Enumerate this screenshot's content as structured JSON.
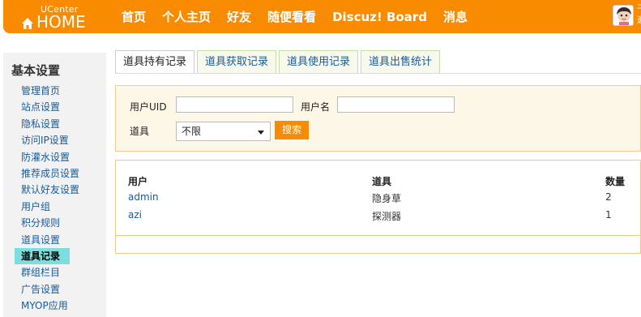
{
  "header": {
    "logo_small": "UCenter",
    "logo_main": "HOME",
    "nav": [
      "首页",
      "个人主页",
      "好友",
      "随便看看",
      "Discuz! Board",
      "消息"
    ],
    "user_tail": "干\n邀"
  },
  "sidebar": {
    "title": "基本设置",
    "items": [
      {
        "label": "管理首页",
        "active": false
      },
      {
        "label": "站点设置",
        "active": false
      },
      {
        "label": "隐私设置",
        "active": false
      },
      {
        "label": "访问IP设置",
        "active": false
      },
      {
        "label": "防灌水设置",
        "active": false
      },
      {
        "label": "推荐成员设置",
        "active": false
      },
      {
        "label": "默认好友设置",
        "active": false
      },
      {
        "label": "用户组",
        "active": false
      },
      {
        "label": "积分规则",
        "active": false
      },
      {
        "label": "道具设置",
        "active": false
      },
      {
        "label": "道具记录",
        "active": true
      },
      {
        "label": "群组栏目",
        "active": false
      },
      {
        "label": "广告设置",
        "active": false
      },
      {
        "label": "MYOP应用",
        "active": false
      }
    ]
  },
  "tabs": [
    {
      "label": "道具持有记录",
      "active": true
    },
    {
      "label": "道具获取记录",
      "active": false
    },
    {
      "label": "道具使用记录",
      "active": false
    },
    {
      "label": "道具出售统计",
      "active": false
    }
  ],
  "search": {
    "uid_label": "用户UID",
    "uid_value": "",
    "username_label": "用户名",
    "username_value": "",
    "item_label": "道具",
    "item_selected": "不限",
    "search_button": "搜索"
  },
  "table": {
    "headers": [
      "用户",
      "道具",
      "数量"
    ],
    "rows": [
      {
        "user": "admin",
        "item": "隐身草",
        "count": "2"
      },
      {
        "user": "azi",
        "item": "探测器",
        "count": "1"
      }
    ]
  },
  "colors": {
    "accent": "#f98b00",
    "active_menu": "#7cdede",
    "link": "#1a5a96"
  }
}
